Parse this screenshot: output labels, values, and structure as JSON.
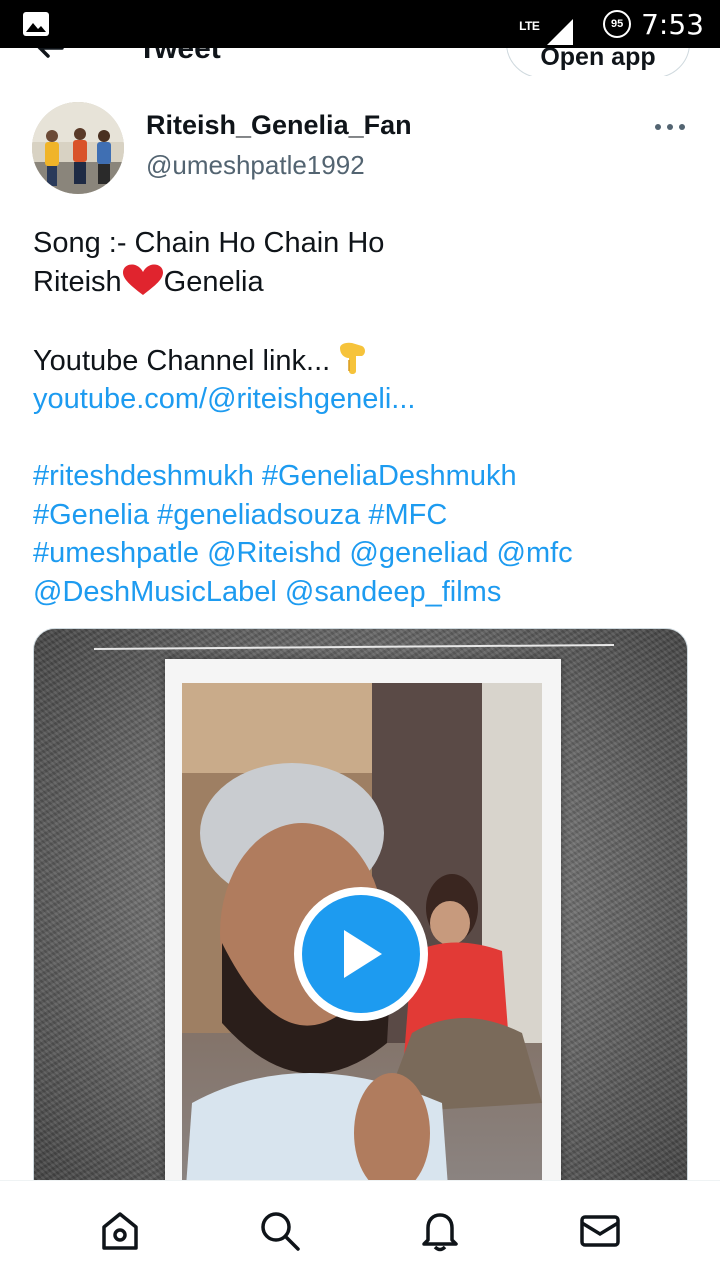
{
  "status_bar": {
    "network": "LTE",
    "battery": "95",
    "time": "7:53"
  },
  "header": {
    "title": "Tweet",
    "open_app_label": "Open app"
  },
  "author": {
    "name": "Riteish_Genelia_Fan",
    "handle": "@umeshpatle1992"
  },
  "tweet": {
    "line1": "Song :- Chain Ho Chain Ho",
    "line2_a": "Riteish",
    "line2_b": "Genelia",
    "line3": "Youtube Channel link...",
    "link": "youtube.com/@riteishgeneli...",
    "tags_line1": "#riteshdeshmukh #GeneliaDeshmukh",
    "tags_line2": "#Genelia #geneliadsouza #MFC",
    "tags_line3": "#umeshpatle @Riteishd @geneliad @mfc",
    "tags_line4": "@DeshMusicLabel @sandeep_films"
  },
  "icons": {
    "gallery": "gallery-icon",
    "back": "arrow-left-icon",
    "more": "more-horizontal-icon",
    "heart": "red-heart-emoji",
    "pointing": "backhand-index-pointing-down-emoji",
    "play": "play-icon",
    "home": "home-icon",
    "search": "search-icon",
    "notifications": "bell-icon",
    "messages": "mail-icon"
  },
  "colors": {
    "link": "#1d9bf0",
    "text": "#0f1419",
    "secondary": "#536471",
    "play_button": "#1d9bf0"
  }
}
